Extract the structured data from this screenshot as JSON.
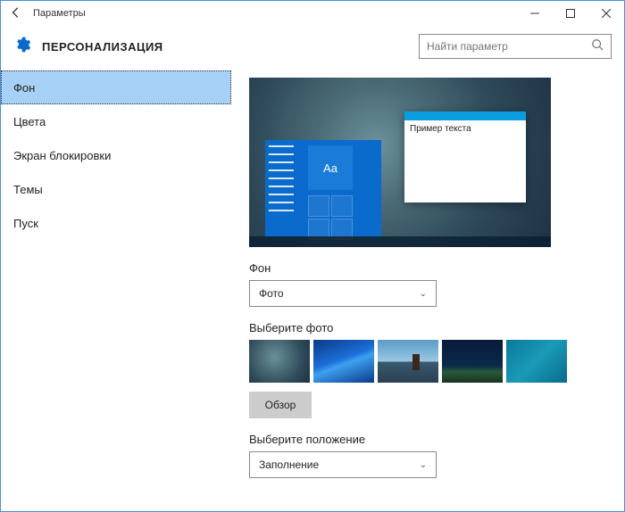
{
  "titlebar": {
    "title": "Параметры"
  },
  "header": {
    "title": "ПЕРСОНАЛИЗАЦИЯ",
    "search_placeholder": "Найти параметр"
  },
  "sidebar": {
    "items": [
      {
        "label": "Фон"
      },
      {
        "label": "Цвета"
      },
      {
        "label": "Экран блокировки"
      },
      {
        "label": "Темы"
      },
      {
        "label": "Пуск"
      }
    ],
    "active_index": 0
  },
  "content": {
    "preview": {
      "sample_text": "Пример текста",
      "aa": "Aa"
    },
    "background_label": "Фон",
    "background_dropdown": {
      "selected": "Фото"
    },
    "choose_photo_label": "Выберите фото",
    "browse_button": "Обзор",
    "position_label": "Выберите положение",
    "position_dropdown": {
      "selected": "Заполнение"
    }
  }
}
